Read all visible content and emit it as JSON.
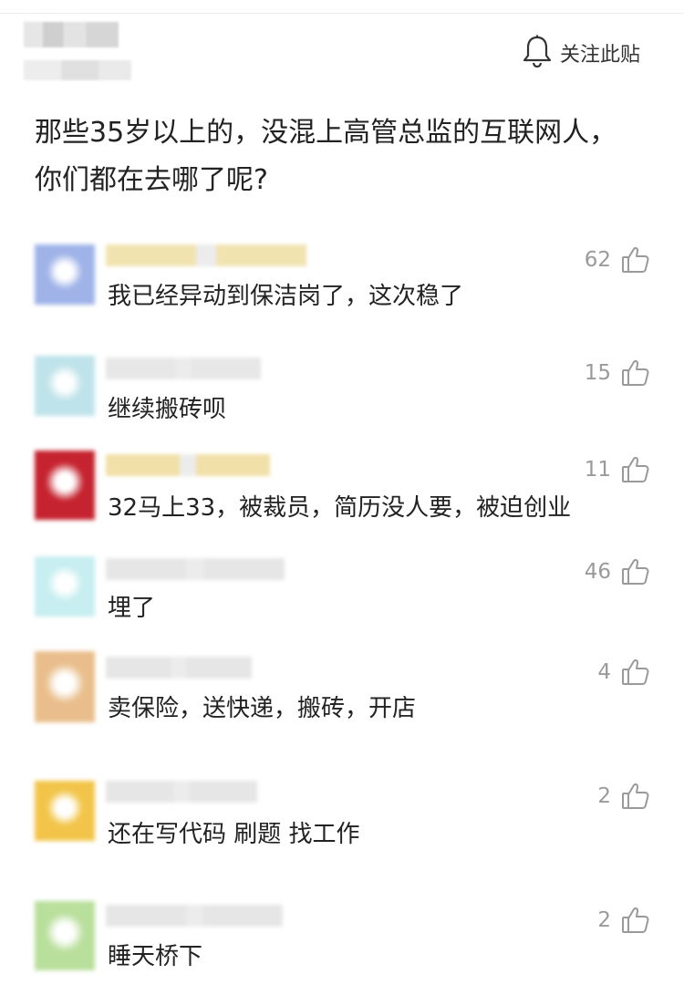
{
  "post": {
    "follow_label": "关注此贴",
    "title": "那些35岁以上的，没混上高管总监的互联网人，你们都在去哪了呢?"
  },
  "comments": [
    {
      "text": "我已经异动到保洁岗了，这次稳了",
      "likes": "62",
      "avatar_color": "#9fb3e8",
      "name_color": "#f1e3b0"
    },
    {
      "text": "继续搬砖呗",
      "likes": "15",
      "avatar_color": "#bfe3ea",
      "name_color": "#e7e7e7"
    },
    {
      "text": "32马上33，被裁员，简历没人要，被迫创业",
      "likes": "11",
      "avatar_color": "#c5232f",
      "name_color": "#f1e0a8"
    },
    {
      "text": "埋了",
      "likes": "46",
      "avatar_color": "#c7eef0",
      "name_color": "#e6e6e6"
    },
    {
      "text": "卖保险，送快递，搬砖，开店",
      "likes": "4",
      "avatar_color": "#e9be8c",
      "name_color": "#e6e6e6"
    },
    {
      "text": "还在写代码 刷题 找工作",
      "likes": "2",
      "avatar_color": "#f2c54a",
      "name_color": "#e6e6e6"
    },
    {
      "text": "睡天桥下",
      "likes": "2",
      "avatar_color": "#b9df9c",
      "name_color": "#e6e6e6"
    }
  ]
}
